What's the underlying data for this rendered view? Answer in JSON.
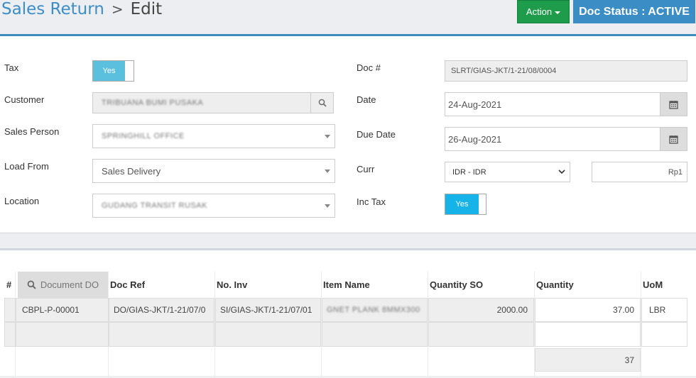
{
  "breadcrumb": {
    "parent": "Sales Return",
    "separator": ">",
    "current": "Edit"
  },
  "actions": {
    "action_label": "Action",
    "doc_status": "Doc Status : ACTIVE"
  },
  "form": {
    "tax": {
      "label": "Tax",
      "value": "Yes"
    },
    "customer": {
      "label": "Customer",
      "value": "TRIBUANA BUMI PUSAKA"
    },
    "sales_person": {
      "label": "Sales Person",
      "value": "SPRINGHILL OFFICE"
    },
    "load_from": {
      "label": "Load From",
      "value": "Sales Delivery"
    },
    "location": {
      "label": "Location",
      "value": "GUDANG TRANSIT RUSAK"
    },
    "doc_no": {
      "label": "Doc #",
      "value": "SLRT/GIAS-JKT/1-21/08/0004"
    },
    "date": {
      "label": "Date",
      "value": "24-Aug-2021"
    },
    "due_date": {
      "label": "Due Date",
      "value": "26-Aug-2021"
    },
    "curr": {
      "label": "Curr",
      "value": "IDR - IDR",
      "rate": "Rp1"
    },
    "inc_tax": {
      "label": "Inc Tax",
      "value": "Yes"
    }
  },
  "grid": {
    "headers": {
      "hash": "#",
      "document_do": "Document DO",
      "doc_ref": "Doc Ref",
      "no_inv": "No. Inv",
      "item_name": "Item Name",
      "qty_so": "Quantity SO",
      "quantity": "Quantity",
      "uom": "UoM"
    },
    "rows": [
      {
        "document_do": "CBPL-P-00001",
        "doc_ref": "DO/GIAS-JKT/1-21/07/0",
        "no_inv": "SI/GIAS-JKT/1-21/07/01",
        "item_name": "GNET PLANK 8MMX300",
        "qty_so": "2000.00",
        "quantity": "37.00",
        "uom": "LBR"
      }
    ],
    "total_quantity": "37"
  },
  "colors": {
    "primary": "#3c8dbc",
    "success": "#1e9c4b",
    "info": "#5bc0de"
  }
}
